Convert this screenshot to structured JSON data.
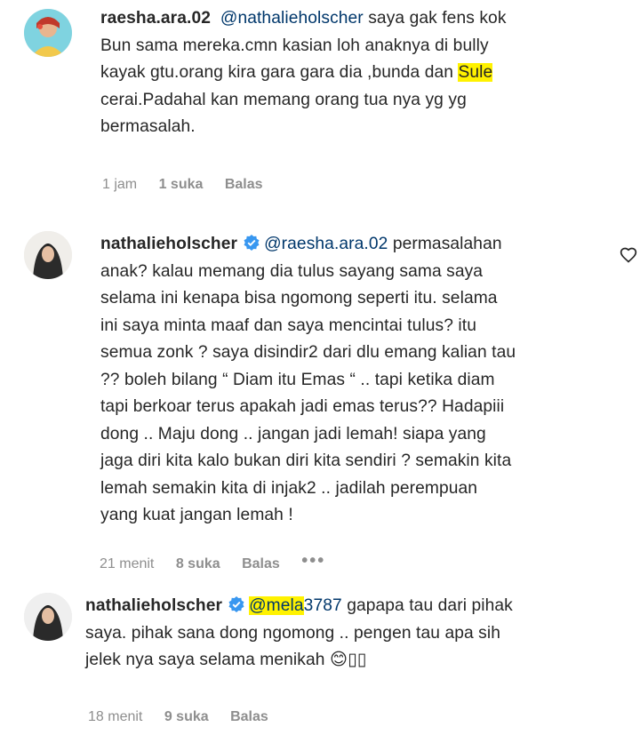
{
  "comments": [
    {
      "username": "raesha.ara.02",
      "lines": [
        {
          "parts": [
            {
              "mention": "@nathalieholscher"
            },
            {
              "text": " saya gak fens kok"
            }
          ]
        },
        {
          "parts": [
            {
              "text": "Bun sama mereka.cmn kasian loh anaknya di bully"
            }
          ]
        },
        {
          "parts": [
            {
              "text": "kayak gtu.orang kira gara gara dia ,bunda dan "
            },
            {
              "highlight": "Sule"
            }
          ]
        },
        {
          "parts": [
            {
              "text": "cerai.Padahal kan memang orang tua nya yg yg"
            }
          ]
        },
        {
          "parts": [
            {
              "text": "bermasalah."
            }
          ]
        }
      ],
      "time": "1 jam",
      "likes": "1 suka",
      "reply": "Balas"
    },
    {
      "username": "nathalieholscher",
      "verified": true,
      "lines": [
        {
          "parts": [
            {
              "mention": "@raesha.ara.02"
            },
            {
              "text": " permasalahan"
            }
          ]
        },
        {
          "parts": [
            {
              "text": "anak? kalau memang dia tulus sayang sama saya"
            }
          ]
        },
        {
          "parts": [
            {
              "text": "selama ini kenapa bisa ngomong seperti itu. selama"
            }
          ]
        },
        {
          "parts": [
            {
              "text": "ini saya minta maaf dan saya mencintai tulus? itu"
            }
          ]
        },
        {
          "parts": [
            {
              "text": "semua zonk ? saya disindir2 dari dlu emang kalian tau"
            }
          ]
        },
        {
          "parts": [
            {
              "text": "?? boleh bilang “ Diam itu Emas “ .. tapi ketika diam"
            }
          ]
        },
        {
          "parts": [
            {
              "text": "tapi berkoar terus apakah jadi emas terus?? Hadapiii"
            }
          ]
        },
        {
          "parts": [
            {
              "text": "dong .. Maju dong .. jangan jadi lemah! siapa yang"
            }
          ]
        },
        {
          "parts": [
            {
              "text": "jaga diri kita kalo bukan diri kita sendiri ? semakin kita"
            }
          ]
        },
        {
          "parts": [
            {
              "text": "lemah semakin kita di injak2 .. jadilah perempuan"
            }
          ]
        },
        {
          "parts": [
            {
              "text": "yang kuat jangan lemah !"
            }
          ]
        }
      ],
      "time": "21 menit",
      "likes": "8 suka",
      "reply": "Balas",
      "more": "•••"
    },
    {
      "username": "nathalieholscher",
      "verified": true,
      "lines": [
        {
          "parts": [
            {
              "mention_highlight": "@mela"
            },
            {
              "mention": "3787"
            },
            {
              "text": " gapapa tau dari pihak"
            }
          ]
        },
        {
          "parts": [
            {
              "text": "saya. pihak sana dong ngomong .. pengen tau apa sih"
            }
          ]
        },
        {
          "parts": [
            {
              "text": "jelek nya saya selama menikah 😊▯▯"
            }
          ]
        }
      ],
      "time": "18 menit",
      "likes": "9 suka",
      "reply": "Balas"
    }
  ]
}
